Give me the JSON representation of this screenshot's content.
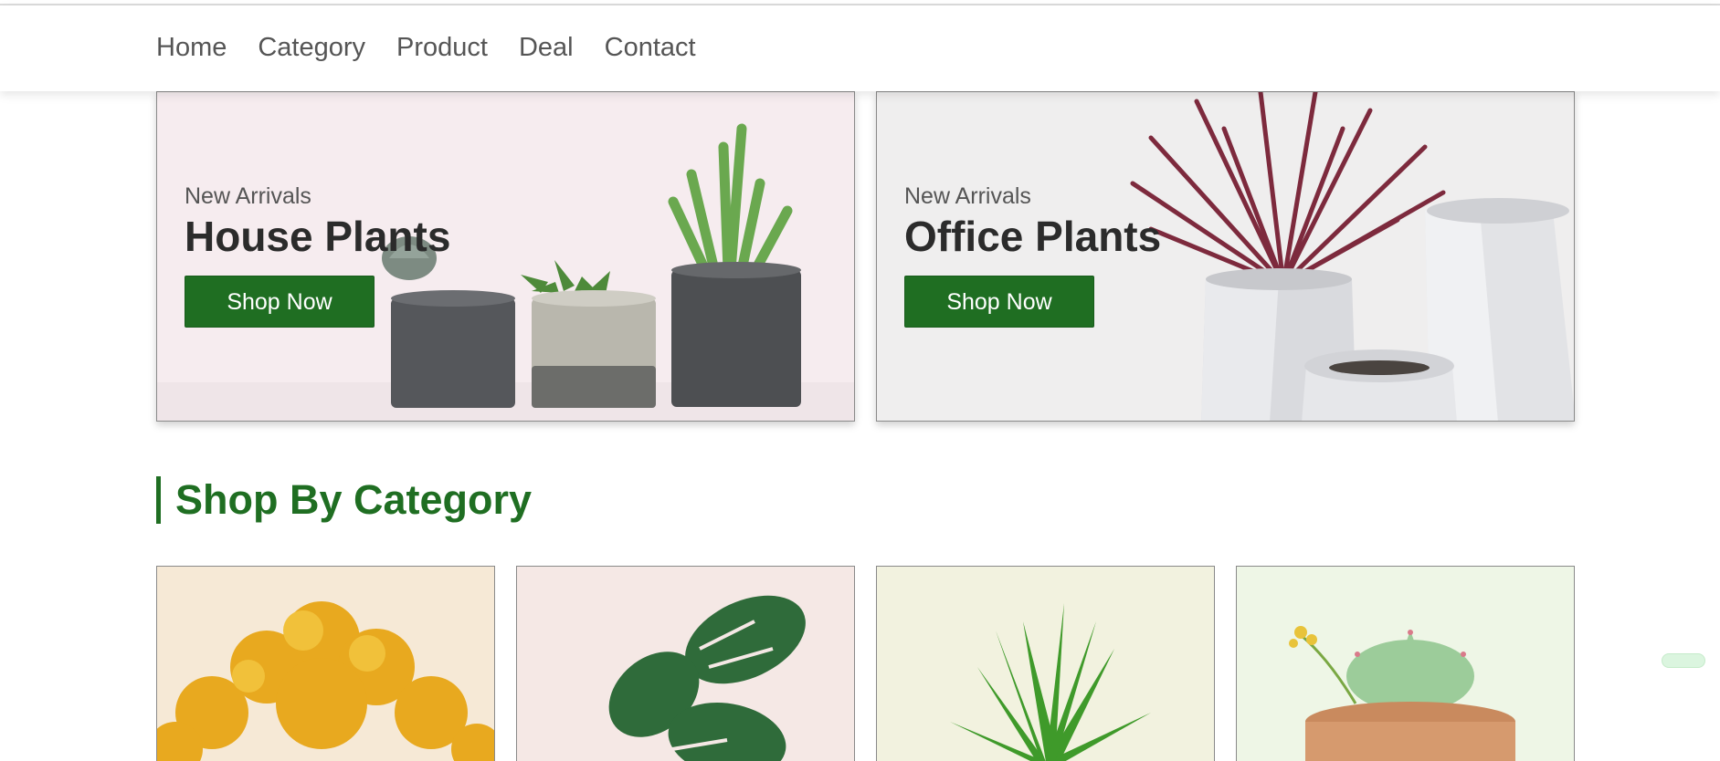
{
  "nav": {
    "links": [
      "Home",
      "Category",
      "Product",
      "Deal",
      "Contact"
    ]
  },
  "banners": [
    {
      "subtitle": "New Arrivals",
      "title": "House Plants",
      "button": "Shop Now"
    },
    {
      "subtitle": "New Arrivals",
      "title": "Office Plants",
      "button": "Shop Now"
    }
  ],
  "section": {
    "title": "Shop By Category"
  },
  "categories": [
    {
      "image": "yellow-bonsai-tree"
    },
    {
      "image": "monstera-leaves"
    },
    {
      "image": "dracaena-plant"
    },
    {
      "image": "succulent-in-terracotta-pot"
    }
  ],
  "colors": {
    "brand_green": "#1f6e22",
    "button_text": "#ffffff",
    "float_widget": "#dbf5df"
  }
}
